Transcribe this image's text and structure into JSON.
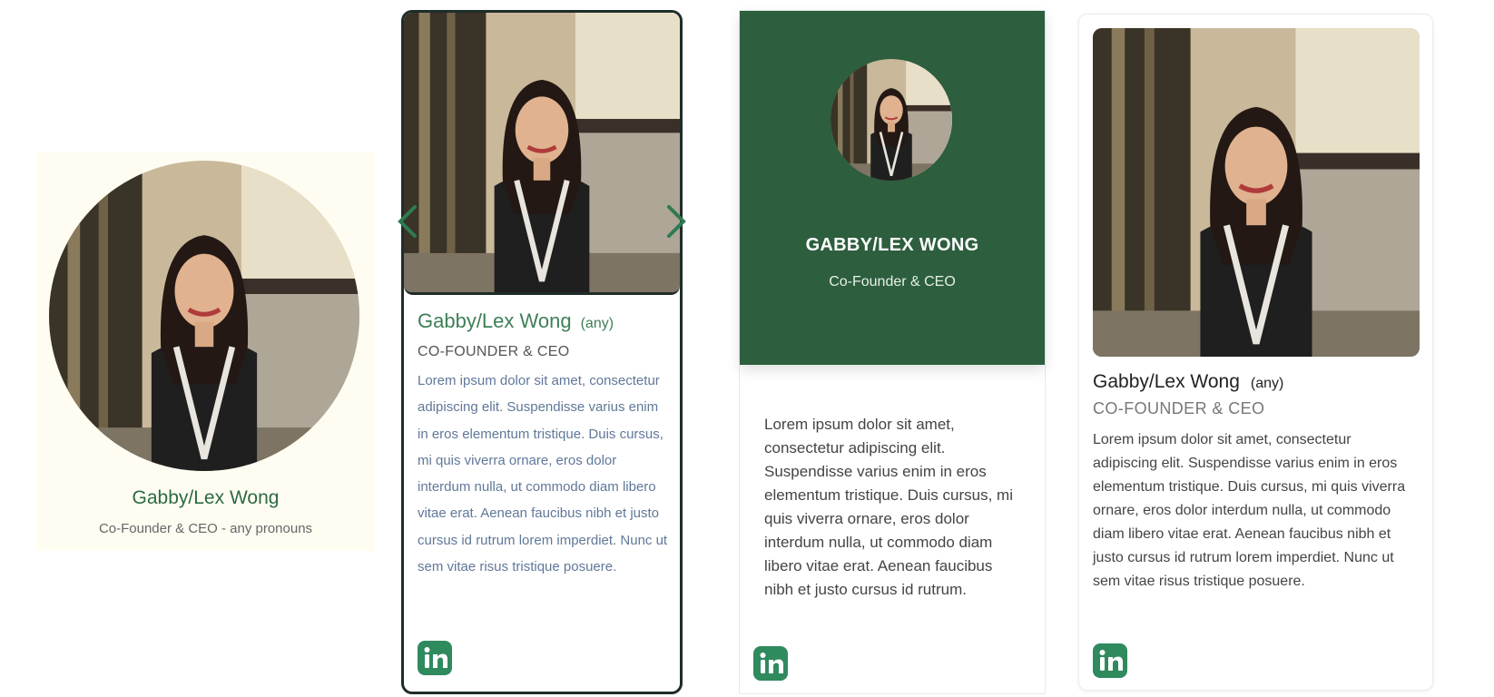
{
  "colors": {
    "accent_green": "#2f8a5e",
    "header_green": "#2d5e3e",
    "name_green": "#2d6a45",
    "card1_bg": "#fffdf2"
  },
  "card1": {
    "name": "Gabby/Lex Wong",
    "subtitle": "Co-Founder & CEO - any pronouns",
    "photo_icon": "portrait-photo"
  },
  "card2": {
    "name": "Gabby/Lex Wong",
    "pronouns": "(any)",
    "role": "CO-FOUNDER & CEO",
    "bio": "Lorem ipsum dolor sit amet, consectetur adipiscing elit. Suspendisse varius enim in eros elementum tristique. Duis cursus, mi quis viverra ornare, eros dolor interdum nulla, ut commodo diam libero vitae erat. Aenean faucibus nibh et justo cursus id rutrum lorem imperdiet. Nunc ut sem vitae risus tristique posuere.",
    "prev_icon": "chevron-left-icon",
    "next_icon": "chevron-right-icon",
    "social_icon": "linkedin-icon"
  },
  "card3": {
    "name": "GABBY/LEX WONG",
    "role": "Co-Founder & CEO",
    "bio": "Lorem ipsum dolor sit amet, consectetur adipiscing elit. Suspendisse varius enim in eros elementum tristique. Duis cursus, mi quis viverra ornare, eros dolor interdum nulla, ut commodo diam libero vitae erat. Aenean faucibus nibh et justo cursus id rutrum.",
    "social_icon": "linkedin-icon"
  },
  "card4": {
    "name": "Gabby/Lex Wong",
    "pronouns": "(any)",
    "role": "CO-FOUNDER & CEO",
    "bio": "Lorem ipsum dolor sit amet, consectetur adipiscing elit. Suspendisse varius enim in eros elementum tristique. Duis cursus, mi quis viverra ornare, eros dolor interdum nulla, ut commodo diam libero vitae erat. Aenean faucibus nibh et justo cursus id rutrum lorem imperdiet. Nunc ut sem vitae risus tristique posuere.",
    "social_icon": "linkedin-icon"
  }
}
